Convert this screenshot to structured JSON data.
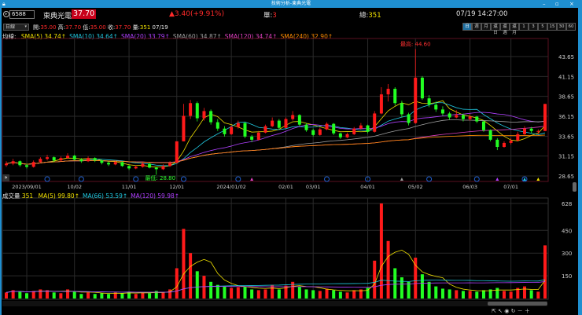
{
  "window": {
    "title": "技術分析-東典光電",
    "controls": [
      "–",
      "▫",
      "×"
    ]
  },
  "quote": {
    "code": "6588",
    "name": "東典光電",
    "price": "37.70",
    "change": "▲3.40(+9.91%)",
    "single_label": "單:",
    "single": "3",
    "total_label": "總:",
    "total": "351",
    "datetime": "07/19 14:27:00"
  },
  "bar": {
    "period_select": "日線",
    "open_label": "開:",
    "open": "35.00",
    "high_label": "高:",
    "high": "37.70",
    "low_label": "低:",
    "low": "35.00",
    "close_label": "收:",
    "close": "37.70",
    "vol_label": "量:",
    "vol": "351",
    "date": "07/19"
  },
  "periods": [
    "日",
    "週",
    "月",
    "還日",
    "還週",
    "還月",
    "1",
    "3",
    "5",
    "15",
    "30",
    "60"
  ],
  "active_period": "日",
  "ma_legend": {
    "label": "均線:",
    "items": [
      {
        "text": "SMA(5) 34.74↑",
        "color": "#f0e000"
      },
      {
        "text": "SMA(10) 34.64↑",
        "color": "#20c8e0"
      },
      {
        "text": "SMA(20) 33.79↑",
        "color": "#b040ff"
      },
      {
        "text": "SMA(60) 34.87↑",
        "color": "#a0a0a0"
      },
      {
        "text": "SMA(120) 34.74↑",
        "color": "#e040c0"
      },
      {
        "text": "SMA(240) 32.90↑",
        "color": "#ff8c00"
      }
    ]
  },
  "vol_legend": {
    "label": "成交量",
    "value": "351",
    "items": [
      {
        "text": "MA(5) 99.80↑",
        "color": "#f0e000"
      },
      {
        "text": "MA(66) 53.59↑",
        "color": "#20c8e0"
      },
      {
        "text": "MA(120) 59.98↑",
        "color": "#b040ff"
      }
    ]
  },
  "colors": {
    "up": "#ff1a1a",
    "down": "#22ff22",
    "grid": "#2a2a2a",
    "frame": "#5a1020"
  },
  "chart_data": [
    {
      "type": "candlestick",
      "price_ticks": [
        "43.65",
        "41.15",
        "38.65",
        "36.15",
        "33.65",
        "31.15",
        "28.65"
      ],
      "ylim": [
        27.8,
        46.0
      ],
      "date_ticks": [
        {
          "label": "2023/09/01",
          "i": 3
        },
        {
          "label": "10/02",
          "i": 10
        },
        {
          "label": "11/01",
          "i": 18
        },
        {
          "label": "12/01",
          "i": 25
        },
        {
          "label": "2024/01/02",
          "i": 33
        },
        {
          "label": "02/01",
          "i": 41
        },
        {
          "label": "03/01",
          "i": 45
        },
        {
          "label": "04/01",
          "i": 53
        },
        {
          "label": "05/02",
          "i": 60
        },
        {
          "label": "06/03",
          "i": 68
        },
        {
          "label": "07/01",
          "i": 74
        }
      ],
      "max_label": "最高: 44.60",
      "min_label": "最低: 28.80",
      "candles": [
        [
          30.0,
          30.5,
          29.8,
          30.2,
          40
        ],
        [
          30.2,
          30.8,
          30.0,
          30.5,
          55
        ],
        [
          30.5,
          30.6,
          29.8,
          30.0,
          45
        ],
        [
          30.0,
          30.2,
          29.6,
          29.8,
          35
        ],
        [
          29.8,
          30.6,
          29.7,
          30.4,
          50
        ],
        [
          30.4,
          31.0,
          30.3,
          30.8,
          60
        ],
        [
          30.8,
          31.3,
          30.6,
          31.0,
          55
        ],
        [
          31.0,
          31.1,
          30.4,
          30.6,
          40
        ],
        [
          30.6,
          31.1,
          30.5,
          30.9,
          35
        ],
        [
          30.9,
          31.5,
          30.8,
          31.2,
          60
        ],
        [
          31.2,
          31.3,
          30.6,
          30.7,
          45
        ],
        [
          30.7,
          30.9,
          30.3,
          30.5,
          30
        ],
        [
          30.5,
          31.1,
          30.4,
          30.9,
          40
        ],
        [
          30.9,
          31.0,
          30.4,
          30.6,
          30
        ],
        [
          30.6,
          30.7,
          30.1,
          30.3,
          35
        ],
        [
          30.3,
          30.5,
          29.9,
          30.1,
          30
        ],
        [
          30.1,
          30.6,
          30.0,
          30.4,
          40
        ],
        [
          30.4,
          30.5,
          29.8,
          29.9,
          35
        ],
        [
          29.9,
          30.0,
          29.4,
          29.6,
          45
        ],
        [
          29.6,
          30.0,
          29.5,
          29.8,
          30
        ],
        [
          29.8,
          30.4,
          29.7,
          30.2,
          40
        ],
        [
          30.2,
          30.3,
          29.6,
          29.7,
          35
        ],
        [
          29.7,
          29.8,
          28.8,
          29.5,
          50
        ],
        [
          29.5,
          30.1,
          29.4,
          29.9,
          40
        ],
        [
          29.9,
          30.5,
          29.8,
          30.3,
          60
        ],
        [
          30.3,
          33.0,
          30.2,
          33.0,
          200
        ],
        [
          33.0,
          37.7,
          33.0,
          36.2,
          460
        ],
        [
          36.2,
          38.2,
          35.8,
          37.8,
          300
        ],
        [
          37.8,
          38.0,
          35.5,
          35.9,
          180
        ],
        [
          35.9,
          37.2,
          35.6,
          36.8,
          150
        ],
        [
          36.8,
          37.0,
          35.1,
          35.4,
          110
        ],
        [
          35.4,
          35.8,
          34.3,
          34.6,
          90
        ],
        [
          34.6,
          34.9,
          33.6,
          33.9,
          80
        ],
        [
          33.9,
          35.0,
          33.8,
          34.8,
          70
        ],
        [
          34.8,
          35.6,
          34.6,
          35.3,
          75
        ],
        [
          35.3,
          35.4,
          33.4,
          33.6,
          80
        ],
        [
          33.6,
          33.8,
          32.9,
          33.2,
          60
        ],
        [
          33.2,
          34.3,
          33.1,
          34.1,
          55
        ],
        [
          34.1,
          35.1,
          34.0,
          34.9,
          60
        ],
        [
          34.9,
          36.0,
          34.8,
          35.6,
          90
        ],
        [
          35.6,
          35.8,
          34.5,
          34.7,
          60
        ],
        [
          34.7,
          36.0,
          34.6,
          35.8,
          85
        ],
        [
          35.8,
          36.8,
          35.6,
          36.3,
          110
        ],
        [
          36.3,
          36.4,
          34.9,
          35.1,
          80
        ],
        [
          35.1,
          35.3,
          34.2,
          34.4,
          60
        ],
        [
          34.4,
          34.6,
          33.6,
          33.8,
          55
        ],
        [
          33.8,
          34.7,
          33.7,
          34.5,
          50
        ],
        [
          34.5,
          35.4,
          34.4,
          35.2,
          65
        ],
        [
          35.2,
          35.3,
          33.8,
          34.0,
          55
        ],
        [
          34.0,
          34.1,
          33.3,
          33.5,
          45
        ],
        [
          33.5,
          34.1,
          33.4,
          33.9,
          40
        ],
        [
          33.9,
          34.8,
          33.8,
          34.6,
          55
        ],
        [
          34.6,
          35.3,
          34.5,
          35.0,
          60
        ],
        [
          35.0,
          35.1,
          34.0,
          34.2,
          70
        ],
        [
          34.2,
          36.8,
          34.1,
          36.5,
          250
        ],
        [
          36.5,
          39.8,
          36.4,
          38.9,
          628
        ],
        [
          38.9,
          40.2,
          38.0,
          39.6,
          380
        ],
        [
          39.6,
          39.8,
          37.5,
          37.8,
          200
        ],
        [
          37.8,
          38.1,
          36.0,
          36.4,
          140
        ],
        [
          36.4,
          36.6,
          35.0,
          35.3,
          110
        ],
        [
          35.3,
          44.6,
          35.2,
          41.0,
          270
        ],
        [
          41.0,
          41.2,
          38.2,
          38.4,
          160
        ],
        [
          38.4,
          38.8,
          37.3,
          37.6,
          110
        ],
        [
          37.6,
          38.0,
          36.7,
          37.0,
          80
        ],
        [
          37.0,
          37.4,
          36.2,
          36.5,
          65
        ],
        [
          36.5,
          36.7,
          35.7,
          36.0,
          60
        ],
        [
          36.0,
          36.9,
          35.9,
          36.3,
          55
        ],
        [
          36.3,
          36.5,
          35.5,
          35.8,
          50
        ],
        [
          35.8,
          36.4,
          35.6,
          36.1,
          50
        ],
        [
          36.1,
          36.2,
          35.3,
          35.5,
          45
        ],
        [
          35.5,
          35.6,
          34.2,
          34.4,
          55
        ],
        [
          34.4,
          34.5,
          33.0,
          33.2,
          60
        ],
        [
          33.2,
          33.4,
          31.9,
          32.3,
          70
        ],
        [
          32.3,
          33.0,
          32.2,
          32.8,
          50
        ],
        [
          32.8,
          33.4,
          32.6,
          33.1,
          45
        ],
        [
          33.1,
          34.2,
          33.0,
          33.9,
          70
        ],
        [
          33.9,
          34.9,
          33.8,
          34.6,
          80
        ],
        [
          34.6,
          34.8,
          34.0,
          34.3,
          55
        ],
        [
          34.3,
          34.5,
          33.9,
          34.3,
          45
        ],
        [
          34.3,
          37.7,
          34.3,
          37.7,
          351
        ]
      ]
    },
    {
      "type": "bar",
      "name": "成交量",
      "vol_ticks": [
        "628",
        "450",
        "300",
        "150"
      ],
      "ylim": [
        0,
        690
      ]
    }
  ]
}
